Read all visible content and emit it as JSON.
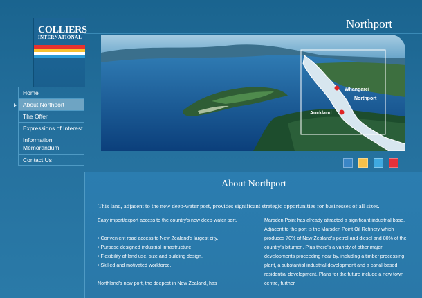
{
  "brand": {
    "name": "COLLIERS",
    "sub": "INTERNATIONAL",
    "stripes": [
      "#e6312e",
      "#f6c130",
      "#ffffff",
      "#2a9ad6"
    ]
  },
  "page": {
    "title": "Northport"
  },
  "map": {
    "labels": {
      "whangarei": "Whangarei",
      "northport": "Northport",
      "auckland": "Auckland"
    }
  },
  "nav": {
    "items": [
      {
        "label": "Home"
      },
      {
        "label": "About Northport",
        "active": true
      },
      {
        "label": "The Offer"
      },
      {
        "label": "Expressions of Interest"
      },
      {
        "label": "Information Memorandum",
        "line1": "Information",
        "line2": "Memorandum"
      },
      {
        "label": "Contact Us"
      }
    ]
  },
  "swatches": {
    "colors": [
      "#3a86c6",
      "#f6c14a",
      "#3fa9e0",
      "#e6313a"
    ]
  },
  "content": {
    "heading": "About Northport",
    "intro": "This land, adjacent to the new deep-water port, provides significant strategic opportunities for businesses of all sizes.",
    "left": {
      "p1": "Easy import/export access to the country's new deep-water port.",
      "bullets": [
        "• Convenient road access to New Zealand's largest city.",
        "• Purpose designed industrial infrastructure.",
        "• Flexibility of land use, size and building design.",
        "• Skilled and motivated workforce."
      ],
      "p2": "Northland's new port, the deepest in New Zealand, has"
    },
    "right": {
      "p1": "Marsden Point has already attracted a significant industrial base. Adjacent to the port is the Marsden Point Oil Refinery which produces 70% of New Zealand's petrol and diesel and 80% of the country's bitumen. Plus there's a variety of other major developments proceeding near by, including a timber processing plant, a substantial industrial development and a canal-based residential development. Plans for the future include a new town centre, further"
    }
  }
}
